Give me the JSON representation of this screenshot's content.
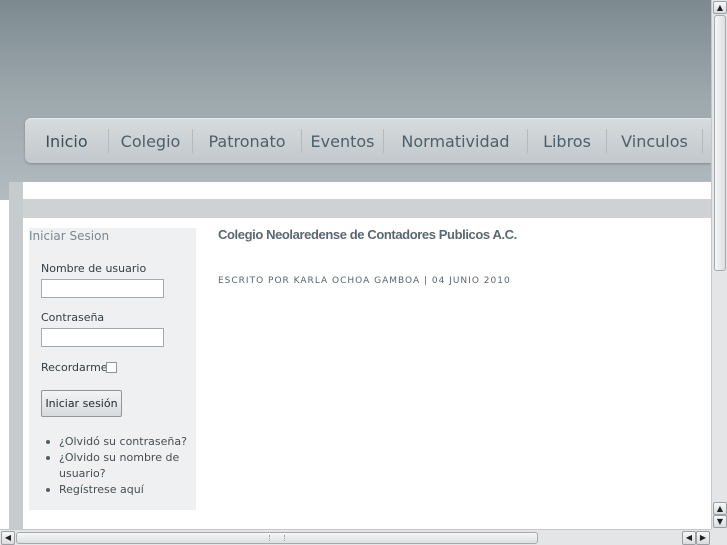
{
  "nav": {
    "items": [
      "Inicio",
      "Colegio",
      "Patronato",
      "Eventos",
      "Normatividad",
      "Libros",
      "Vinculos"
    ]
  },
  "login": {
    "title": "Iniciar Sesion",
    "username_label": "Nombre de usuario",
    "username_value": "",
    "password_label": "Contraseña",
    "password_value": "",
    "remember_label": "Recordarme",
    "remember_checked": false,
    "submit_label": "Iniciar sesión",
    "links": [
      "¿Olvidó su contraseña?",
      "¿Olvido su nombre de usuario?",
      "Regístrese aquí"
    ]
  },
  "article": {
    "title": "Colegio Neolaredense de Contadores Publicos A.C.",
    "meta": "ESCRITO POR KARLA OCHOA GAMBOA | 04 JUNIO 2010"
  },
  "scrollbars": {
    "up_arrow": "▲",
    "down_arrow": "▼",
    "left_arrow": "◀",
    "right_arrow": "▶"
  }
}
